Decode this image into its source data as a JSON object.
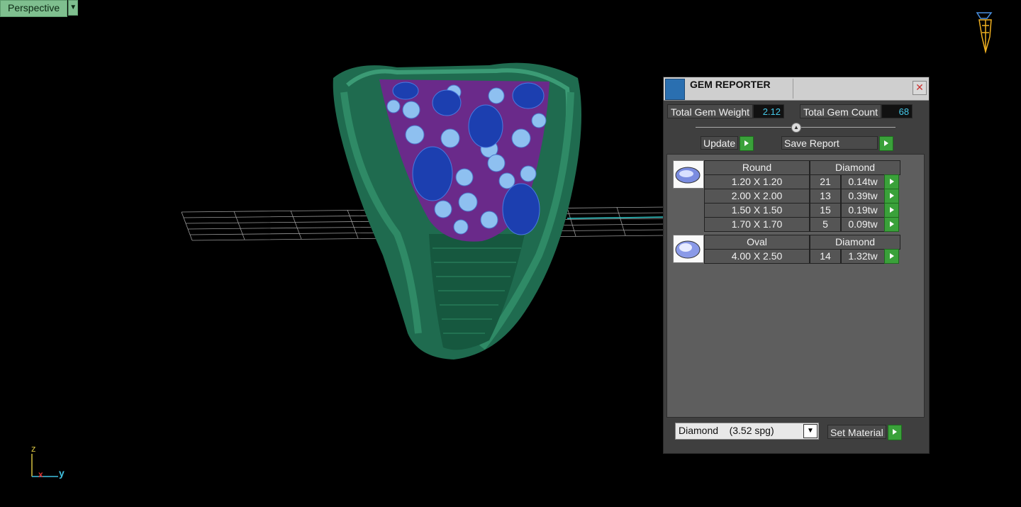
{
  "viewport": {
    "label": "Perspective",
    "dropdown_icon": "dropdown-arrow-icon"
  },
  "axes": {
    "z": "z",
    "y": "y",
    "x": "x"
  },
  "gem_reporter": {
    "title": "GEM REPORTER",
    "close_icon": "close-icon",
    "total_weight_label": "Total Gem Weight",
    "total_weight_value": "2.12",
    "total_count_label": "Total Gem Count",
    "total_count_value": "68",
    "update_label": "Update",
    "save_report_label": "Save Report",
    "groups": [
      {
        "shape": "Round",
        "material": "Diamond",
        "icon": "round-gem-icon",
        "rows": [
          {
            "size": "1.20 X 1.20",
            "count": "21",
            "weight": "0.14tw"
          },
          {
            "size": "2.00 X 2.00",
            "count": "13",
            "weight": "0.39tw"
          },
          {
            "size": "1.50 X 1.50",
            "count": "15",
            "weight": "0.19tw"
          },
          {
            "size": "1.70 X 1.70",
            "count": "5",
            "weight": "0.09tw"
          }
        ]
      },
      {
        "shape": "Oval",
        "material": "Diamond",
        "icon": "oval-gem-icon",
        "rows": [
          {
            "size": "4.00 X 2.50",
            "count": "14",
            "weight": "1.32tw"
          }
        ]
      }
    ],
    "material_select": "Diamond    (3.52 spg)",
    "set_material_label": "Set Material"
  }
}
